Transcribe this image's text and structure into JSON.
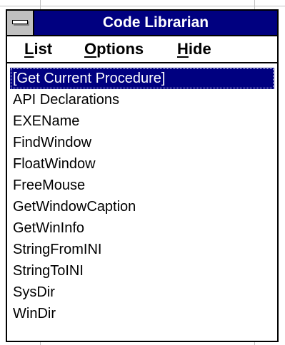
{
  "window": {
    "title": "Code Librarian"
  },
  "menubar": {
    "items": [
      {
        "accel": "L",
        "rest": "ist"
      },
      {
        "accel": "O",
        "rest": "ptions"
      },
      {
        "accel": "H",
        "rest": "ide"
      }
    ]
  },
  "list": {
    "selected_index": 0,
    "items": [
      "[Get Current Procedure]",
      "API Declarations",
      "EXEName",
      "FindWindow",
      "FloatWindow",
      "FreeMouse",
      "GetWindowCaption",
      "GetWinInfo",
      "StringFromINI",
      "StringToINI",
      "SysDir",
      "WinDir"
    ]
  },
  "colors": {
    "title_bar": "#000080",
    "selection": "#000080",
    "system_menu": "#c0c0c0"
  },
  "icons": {
    "system_menu": "system-menu-icon"
  }
}
